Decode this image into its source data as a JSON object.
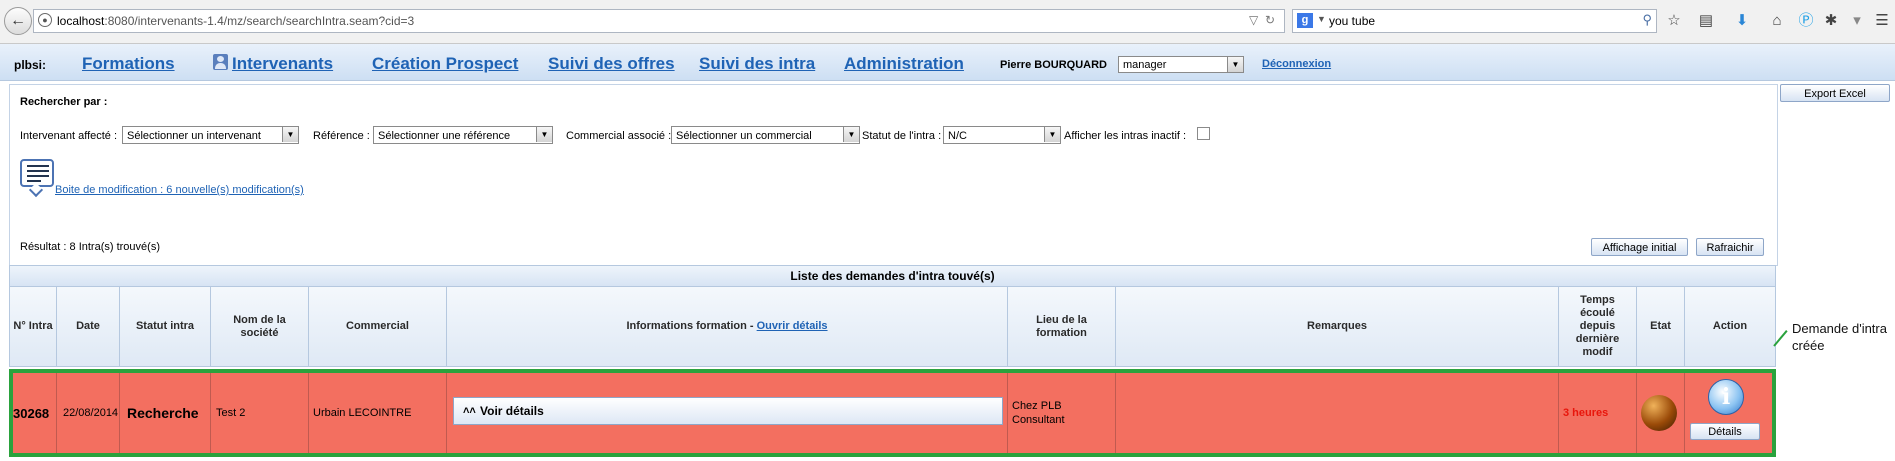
{
  "browser": {
    "url_host": "localhost",
    "url_path": ":8080/intervenants-1.4/mz/search/searchIntra.seam?cid=3",
    "search_query": "you tube",
    "search_engine_letter": "g"
  },
  "app": {
    "name": "plbsi:",
    "nav": {
      "formations": "Formations",
      "intervenants": "Intervenants",
      "creation_prospect": "Création Prospect",
      "suivi_offres": "Suivi des offres",
      "suivi_intra": "Suivi des intra",
      "administration": "Administration"
    },
    "user_name": "Pierre BOURQUARD",
    "role": "manager",
    "logout": "Déconnexion"
  },
  "search": {
    "title": "Rechercher par :",
    "intervenant_label": "Intervenant affecté :",
    "intervenant_value": "Sélectionner un intervenant",
    "reference_label": "Référence :",
    "reference_value": "Sélectionner une référence",
    "commercial_label": "Commercial associé :",
    "commercial_value": "Sélectionner un commercial",
    "statut_label": "Statut de l'intra :",
    "statut_value": "N/C",
    "inactive_label": "Afficher les intras inactif :",
    "show_inactive": false,
    "modification_link": "Boite de modification : 6 nouvelle(s) modification(s)",
    "result_text": "Résultat : 8 Intra(s) trouvé(s)",
    "btn_initial": "Affichage initial",
    "btn_refresh": "Rafraichir",
    "btn_export": "Export Excel"
  },
  "table": {
    "caption": "Liste des demandes d'intra touvé(s)",
    "headers": {
      "num": "N° Intra",
      "date": "Date",
      "statut": "Statut intra",
      "societe": "Nom de la société",
      "commercial": "Commercial",
      "infos": "Informations formation - ",
      "infos_link": "Ouvrir détails",
      "lieu": "Lieu de la formation",
      "remarques": "Remarques",
      "temps": "Temps écoulé depuis dernière modif",
      "etat": "Etat",
      "action": "Action"
    },
    "rows": [
      {
        "num": "30268",
        "date": "22/08/2014",
        "statut": "Recherche",
        "societe": "Test 2",
        "commercial": "Urbain LECOINTRE",
        "voir": "Voir détails",
        "lieu": "Chez PLB Consultant",
        "remarques": "",
        "temps": "3 heures",
        "details_btn": "Détails",
        "row_color": "#f36f60"
      }
    ]
  },
  "annotation": "Demande d'intra créée",
  "colors": {
    "highlight_border": "#2aa23d",
    "link": "#1f63b5",
    "temps_text": "#e8160c"
  }
}
